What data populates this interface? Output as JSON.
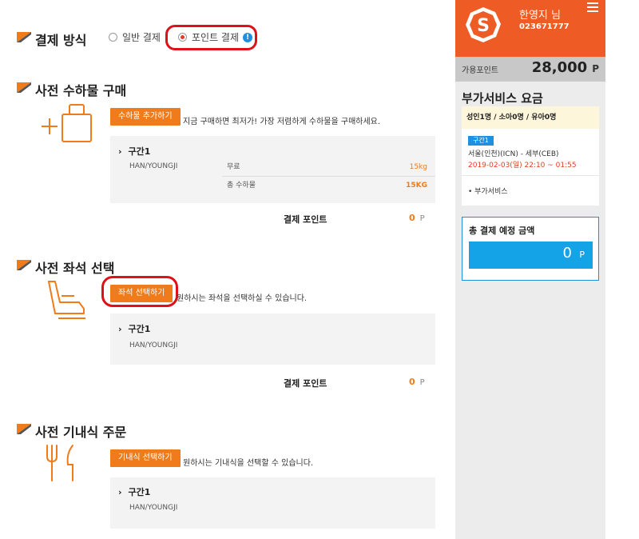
{
  "payment": {
    "title": "결제 방식",
    "option_general": "일반 결제",
    "option_point": "포인트 결제",
    "info": "!"
  },
  "baggage": {
    "title": "사전 수하물 구매",
    "button": "수하물 추가하기",
    "desc": "지금 구매하면 최저가! 가장 저렴하게 수하물을 구매하세요.",
    "segment": "구간1",
    "passenger": "HAN/YOUNGJI",
    "free_label": "무료",
    "free_value": "15kg",
    "total_label": "총 수하물",
    "total_value": "15KG",
    "pay_label": "결제 포인트",
    "pay_value": "0",
    "pay_unit": "P"
  },
  "seat": {
    "title": "사전 좌석 선택",
    "button": "좌석 선택하기",
    "desc": "원하시는 좌석을 선택하실 수 있습니다.",
    "segment": "구간1",
    "passenger": "HAN/YOUNGJI",
    "pay_label": "결제 포인트",
    "pay_value": "0",
    "pay_unit": "P"
  },
  "meal": {
    "title": "사전 기내식 주문",
    "button": "기내식 선택하기",
    "desc": "원하시는 기내식을 선택할 수 있습니다.",
    "segment": "구간1",
    "passenger": "HAN/YOUNGJI"
  },
  "sidebar": {
    "logo_letter": "S",
    "user_name": "한영지 님",
    "user_id": "023671777",
    "points_label": "가용포인트",
    "points_value": "28,000",
    "points_unit": "P",
    "service_title": "부가서비스 요금",
    "pax": "성인1명 / 소아0명 / 유아0명",
    "segment_badge": "구간1",
    "route": "서울(인천)(ICN) - 세부(CEB)",
    "date": "2019-02-03(일) 22:10 ~ 01:55",
    "extra": "• 부가서비스",
    "total_title": "총 결제 예정 금액",
    "total_value": "0",
    "total_unit": "P"
  },
  "colors": {
    "accent_orange": "#f07b1a",
    "brand_orange": "#ee5b24",
    "highlight_red": "#e0101a",
    "blue": "#1f8fe0"
  },
  "icons": {
    "section": "orange-flag-icon",
    "baggage": "luggage-add-icon",
    "seat": "airplane-seat-icon",
    "meal": "fork-knife-icon",
    "menu": "hamburger-menu-icon"
  }
}
